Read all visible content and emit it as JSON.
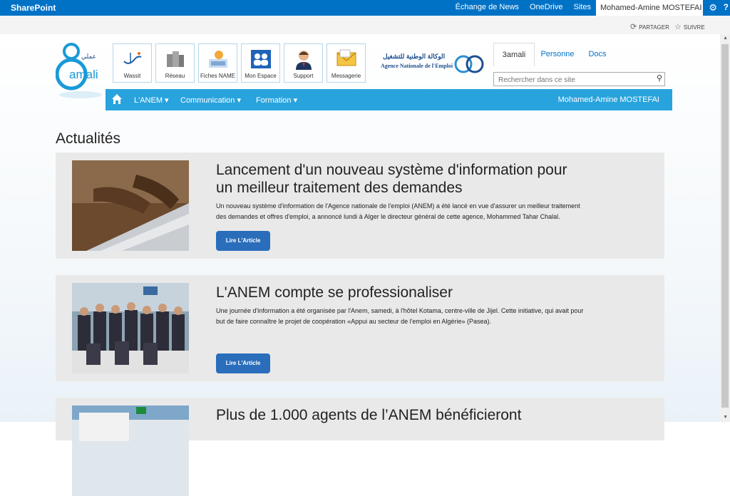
{
  "suitebar": {
    "brand": "SharePoint",
    "links": [
      "Échange de News",
      "OneDrive",
      "Sites"
    ],
    "user": "Mohamed-Amine MOSTEFAI",
    "help": "?"
  },
  "actions": {
    "share": "PARTAGER",
    "follow": "SUIVRE"
  },
  "logo": {
    "arabic": "عملي",
    "latin": "amali"
  },
  "apps": [
    {
      "label": "Wassit",
      "icon": "wassit-icon"
    },
    {
      "label": "Réseau",
      "icon": "servers-icon"
    },
    {
      "label": "Fiches NAME",
      "icon": "name-logo-icon"
    },
    {
      "label": "Mon Espace",
      "icon": "people-icon"
    },
    {
      "label": "Support",
      "icon": "support-agent-icon"
    },
    {
      "label": "Messagerie",
      "icon": "mail-icon"
    }
  ],
  "agency": {
    "arabic": "الوكالة الوطنية للتشغيل",
    "french": "Agence Nationale de l'Emploi"
  },
  "tabs": [
    "3amali",
    "Personne",
    "Docs"
  ],
  "search": {
    "placeholder": "Rechercher dans ce site"
  },
  "nav": {
    "items": [
      "L'ANEM ▾",
      "Communication ▾",
      "Formation ▾"
    ],
    "user": "Mohamed-Amine MOSTEFAI"
  },
  "heading": "Actualités",
  "articles": [
    {
      "title": "Lancement d'un nouveau système d'information pour un meilleur traitement des demandes",
      "body": "Un nouveau système d'information de l'Agence nationale de l'emploi (ANEM) a été lancé en vue d'assurer un meilleur traitement des demandes et offres d'emploi, a annoncé lundi à Alger le directeur général de cette agence, Mohammed Tahar Chalal.",
      "button": "Lire L'Article"
    },
    {
      "title": "L'ANEM compte se professionaliser",
      "body": "Une journée d'information a été organisée par l'Anem, samedi, à l'hôtel Kotama, centre-ville de Jijel. Cette initiative, qui avait pour but de faire connaître le projet de coopération «Appui au secteur de l'emploi en Algérie» (Pasea).",
      "button": "Lire L'Article"
    },
    {
      "title": "Plus de 1.000 agents de l’ANEM bénéficieront",
      "body": "",
      "button": ""
    }
  ],
  "colors": {
    "suitebar": "#0072c6",
    "nav": "#29a3dd",
    "button": "#2a6ebb",
    "card": "#e9e9e9"
  }
}
